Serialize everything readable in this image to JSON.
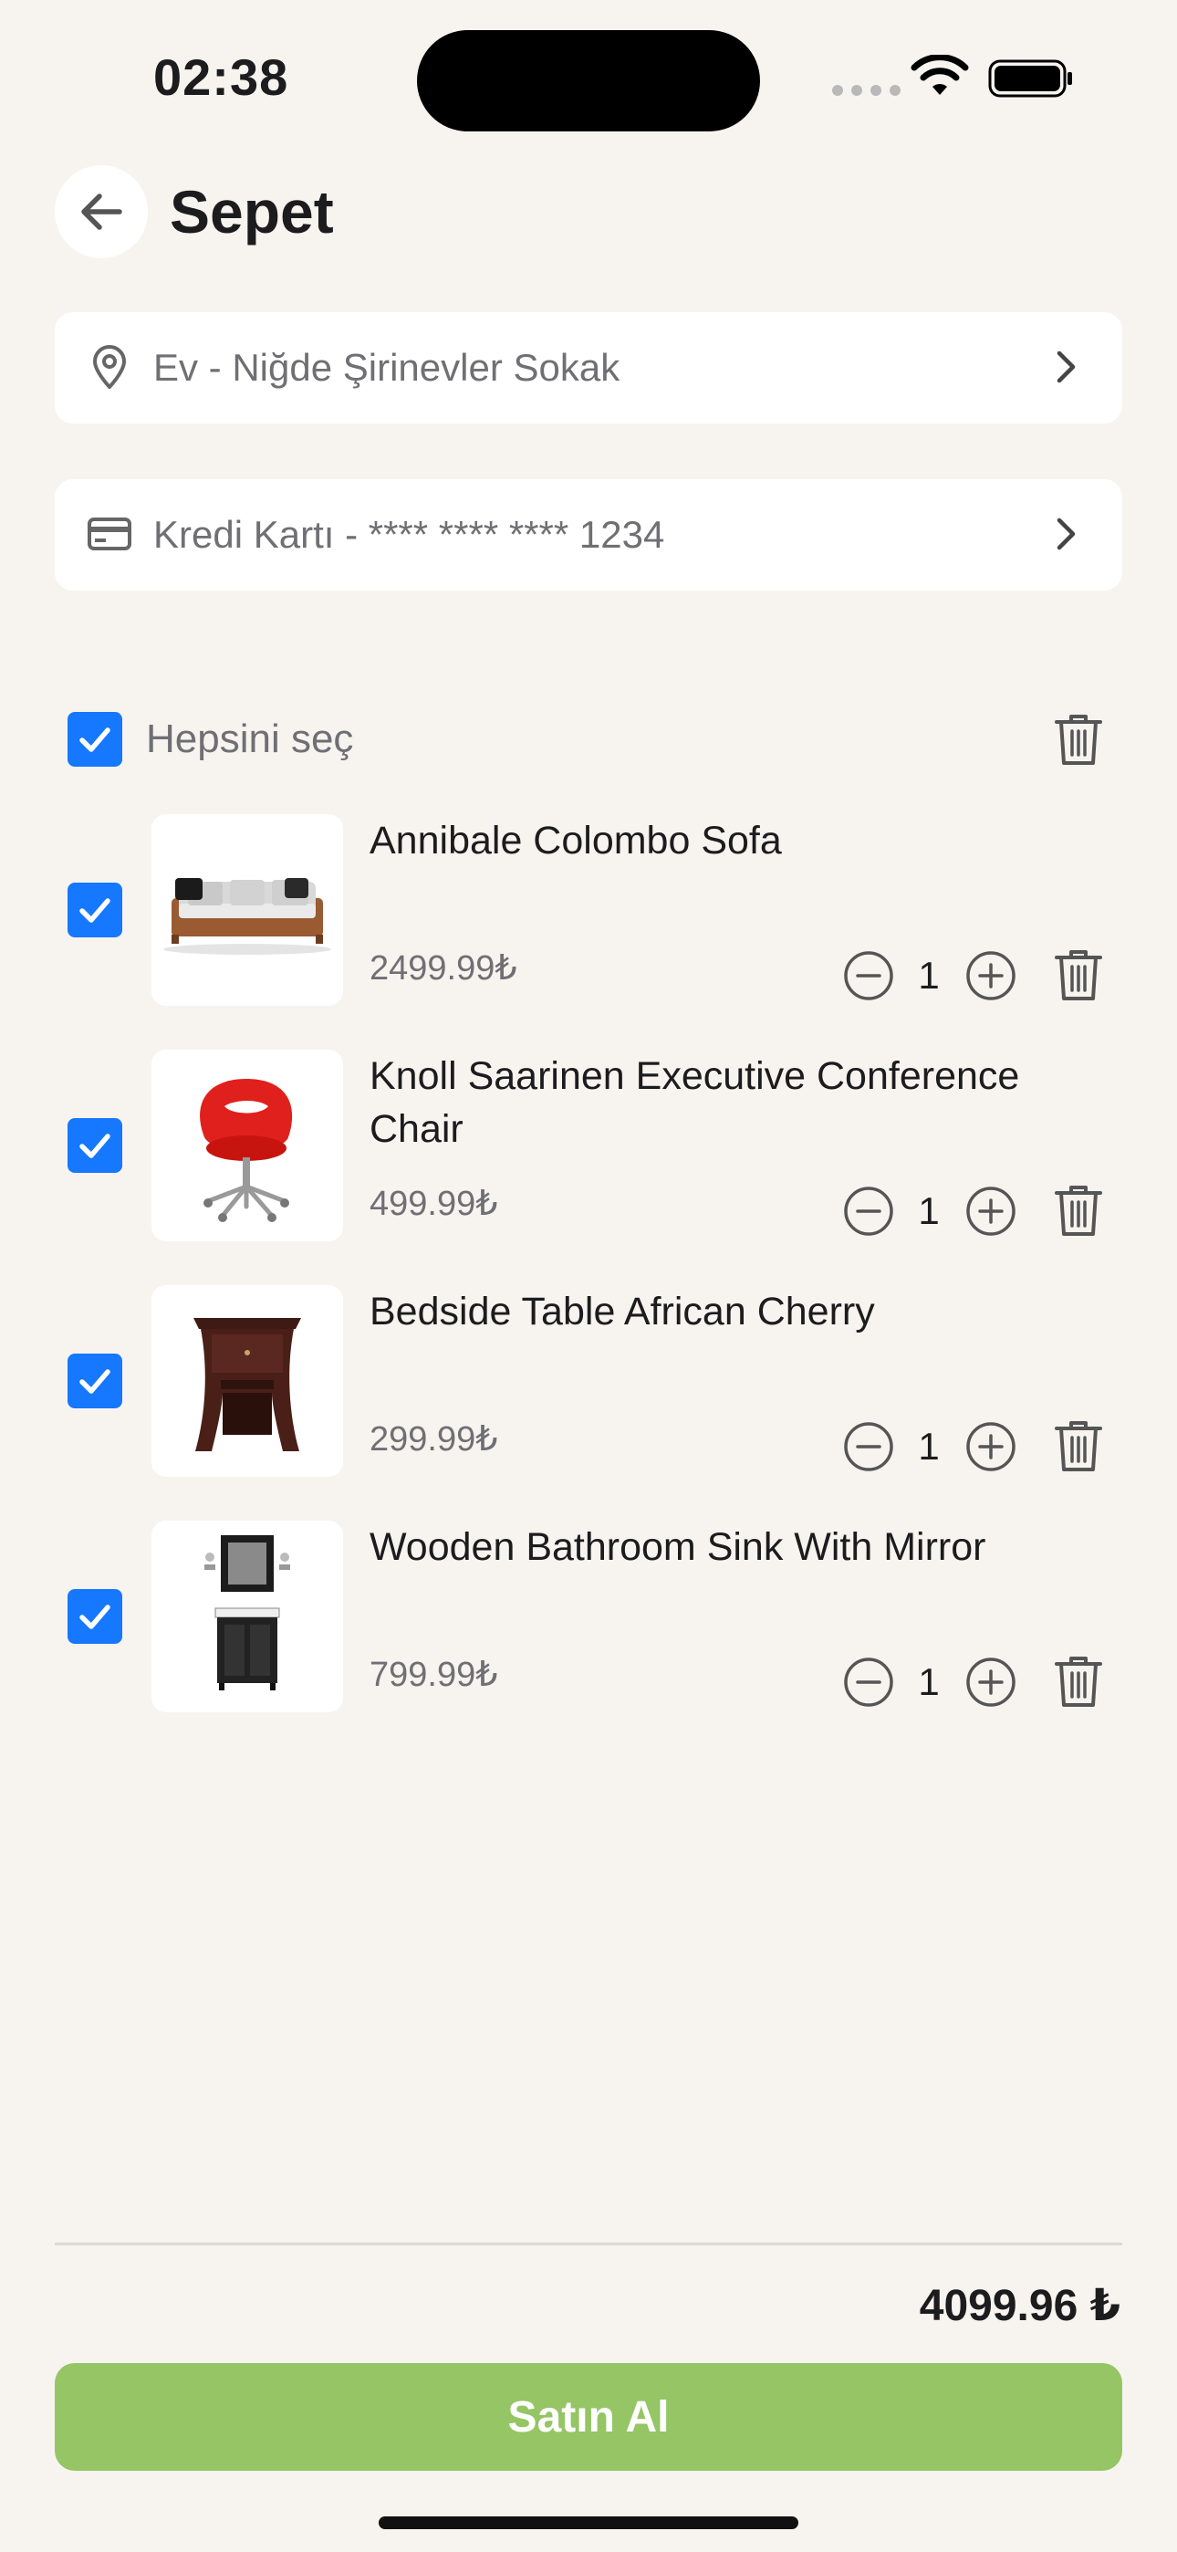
{
  "status_bar": {
    "time": "02:38"
  },
  "header": {
    "title": "Sepet",
    "back_icon": "arrow-left-icon"
  },
  "address": {
    "text": "Ev - Niğde Şirinevler Sokak",
    "icon": "location-pin-icon"
  },
  "payment": {
    "text": "Kredi Kartı - **** **** **** 1234",
    "icon": "credit-card-icon"
  },
  "select_all": {
    "label": "Hepsini seç",
    "checked": true
  },
  "items": [
    {
      "name": "Annibale Colombo Sofa",
      "price": "2499.99₺",
      "quantity": "1",
      "checked": true,
      "image": "sofa"
    },
    {
      "name": "Knoll Saarinen Executive Conference Chair",
      "price": "499.99₺",
      "quantity": "1",
      "checked": true,
      "image": "chair"
    },
    {
      "name": "Bedside Table African Cherry",
      "price": "299.99₺",
      "quantity": "1",
      "checked": true,
      "image": "bedside-table"
    },
    {
      "name": "Wooden Bathroom Sink With Mirror",
      "price": "799.99₺",
      "quantity": "1",
      "checked": true,
      "image": "bathroom-sink"
    }
  ],
  "total": "4099.96 ₺",
  "buy_button": {
    "label": "Satın Al"
  },
  "colors": {
    "accent": "#1677ff",
    "buy": "#95c565",
    "background": "#f7f4f0"
  }
}
